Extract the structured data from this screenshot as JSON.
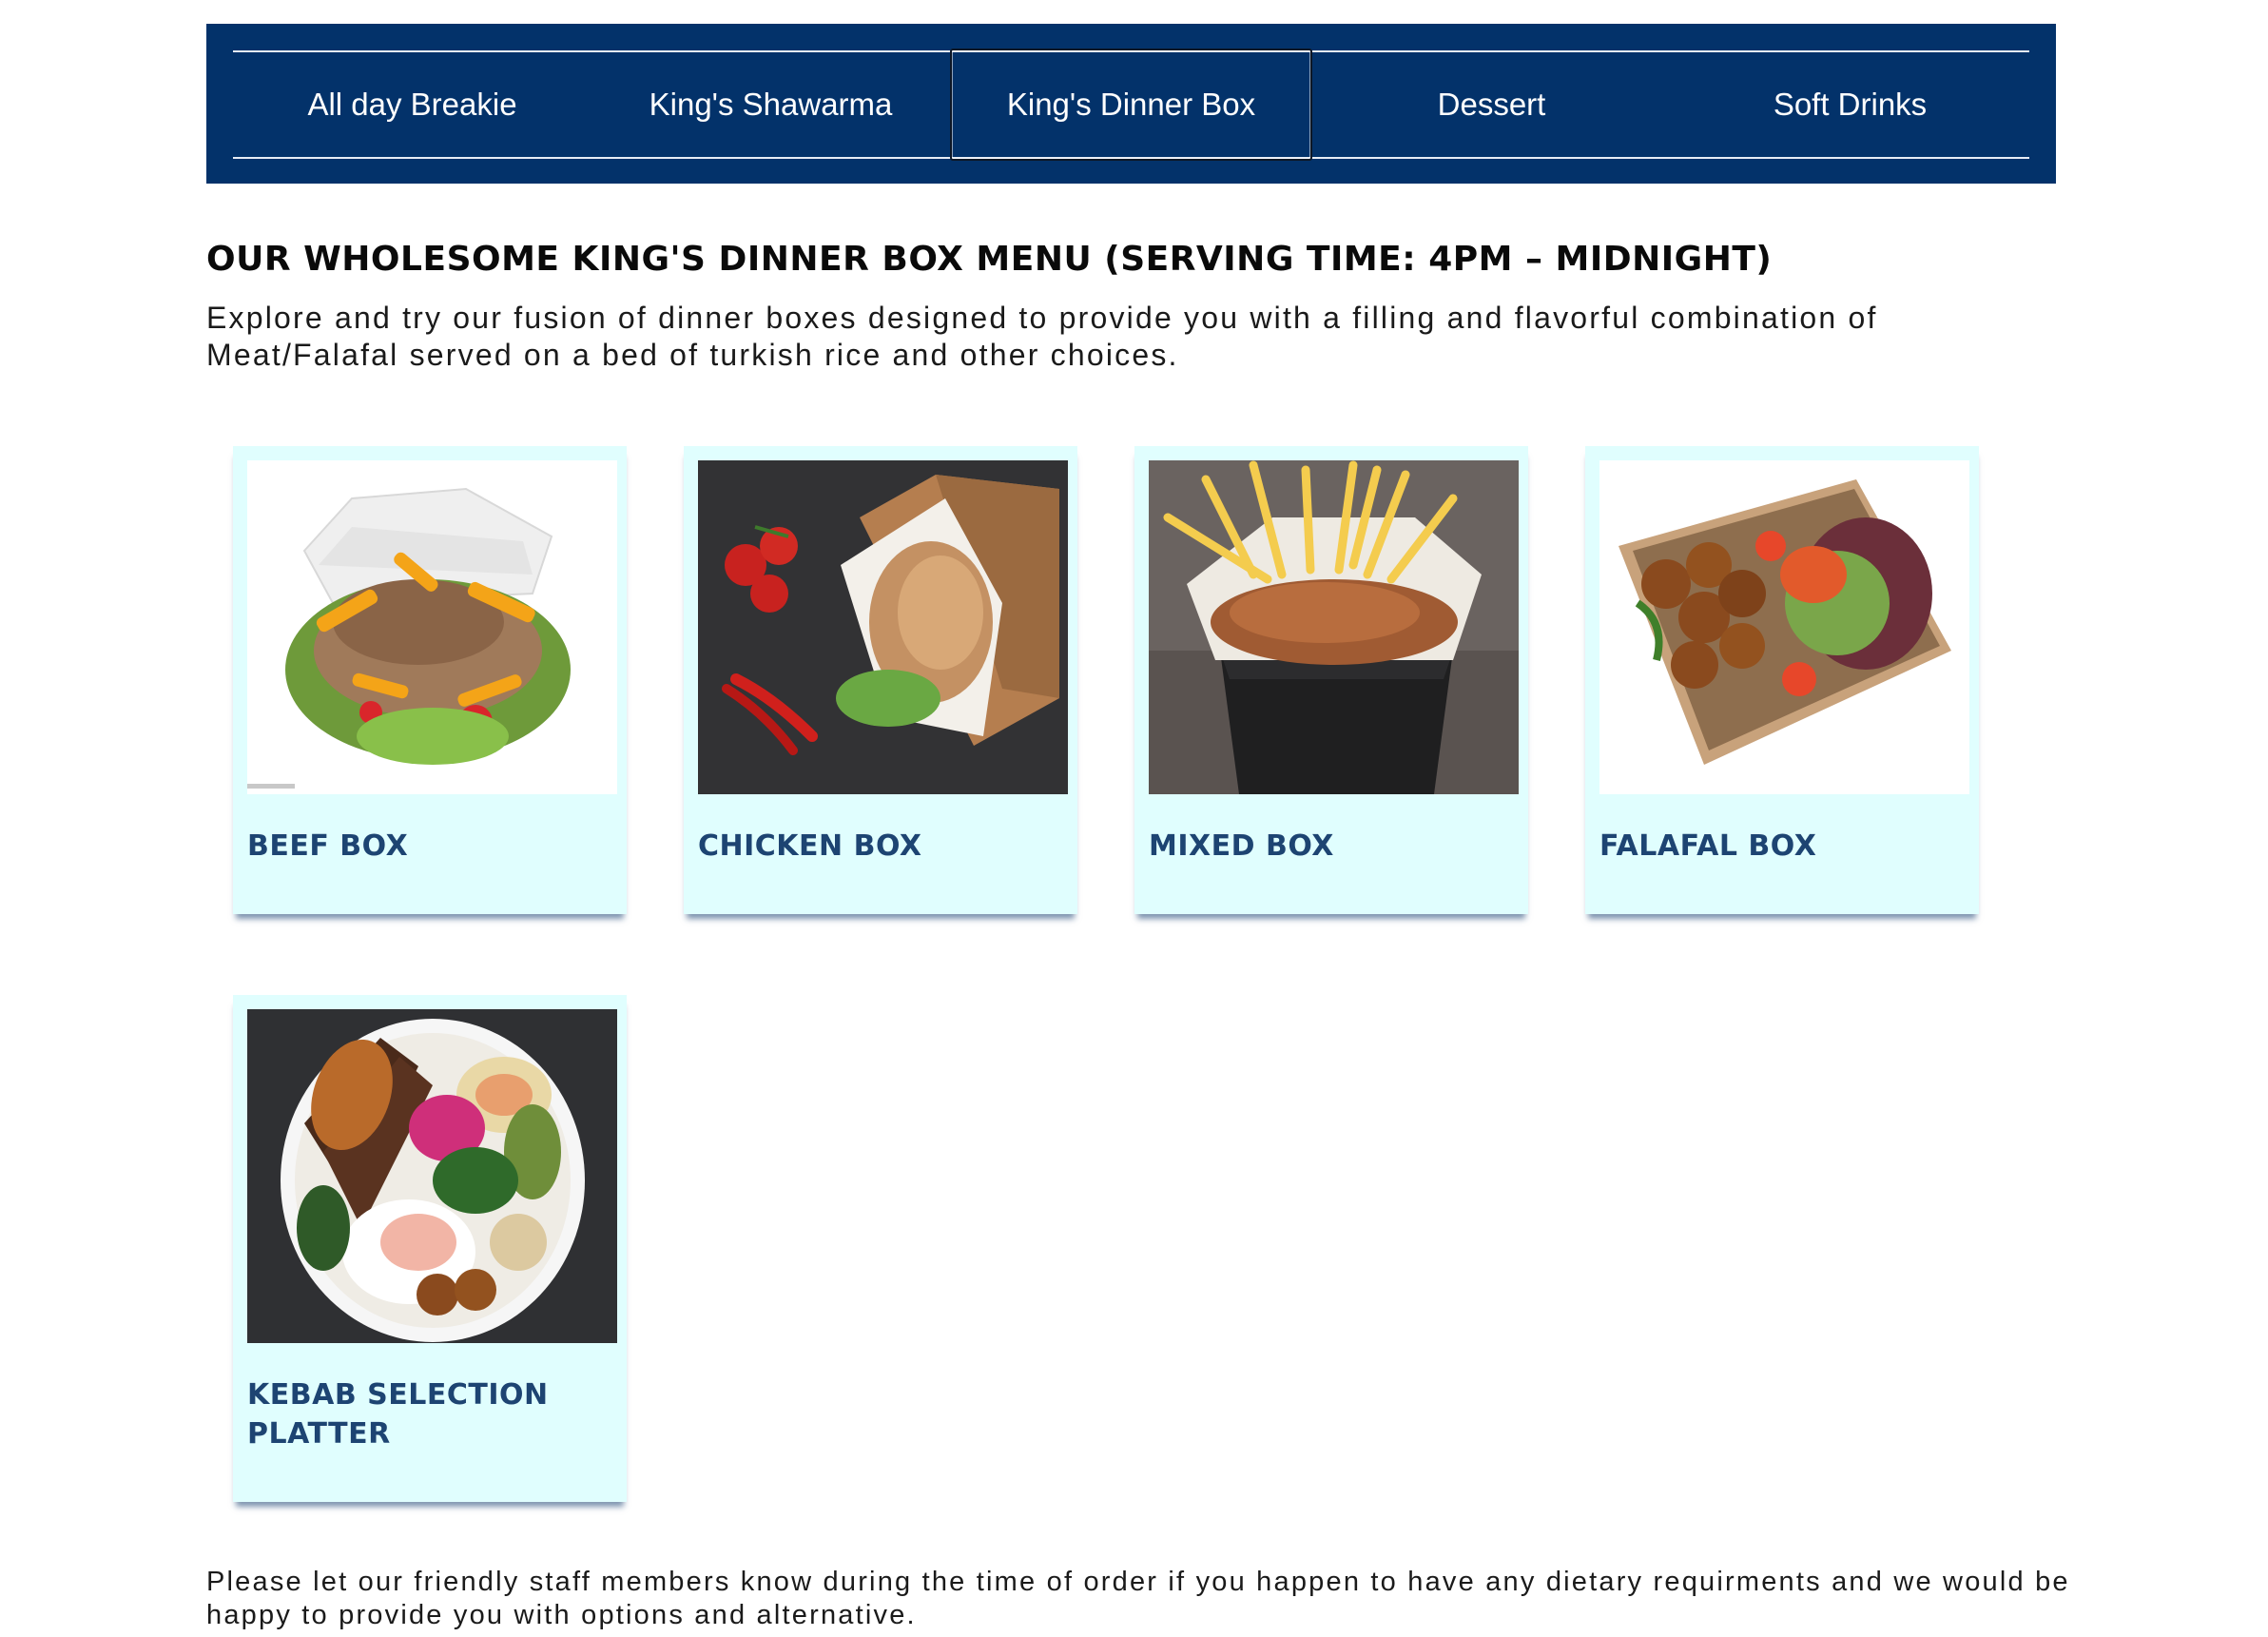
{
  "tabs": [
    {
      "label": "All day Breakie",
      "active": false
    },
    {
      "label": "King's Shawarma",
      "active": false
    },
    {
      "label": "King's Dinner Box",
      "active": true
    },
    {
      "label": "Dessert",
      "active": false
    },
    {
      "label": "Soft Drinks",
      "active": false
    }
  ],
  "section": {
    "heading": "OUR WHOLESOME KING'S DINNER BOX MENU (SERVING TIME: 4PM – MIDNIGHT)",
    "intro": "Explore and try our fusion of dinner boxes designed to provide you with a filling and flavorful combination of Meat/Falafal served on a bed of turkish rice and other choices."
  },
  "items": [
    {
      "title": "BEEF BOX",
      "image": "beef-box-photo"
    },
    {
      "title": "CHICKEN BOX",
      "image": "chicken-box-photo"
    },
    {
      "title": "MIXED BOX",
      "image": "mixed-box-photo"
    },
    {
      "title": "FALAFAL BOX",
      "image": "falafal-box-photo"
    },
    {
      "title": "KEBAB SELECTION PLATTER",
      "image": "kebab-platter-photo"
    }
  ],
  "footer": {
    "note": "Please let our friendly staff members know during the time of order if you happen to have any dietary requirments and we would be happy to provide you with options and alternative."
  },
  "colors": {
    "nav_background": "#03326a",
    "card_background": "#e0fefe",
    "card_title": "#1d4472"
  }
}
